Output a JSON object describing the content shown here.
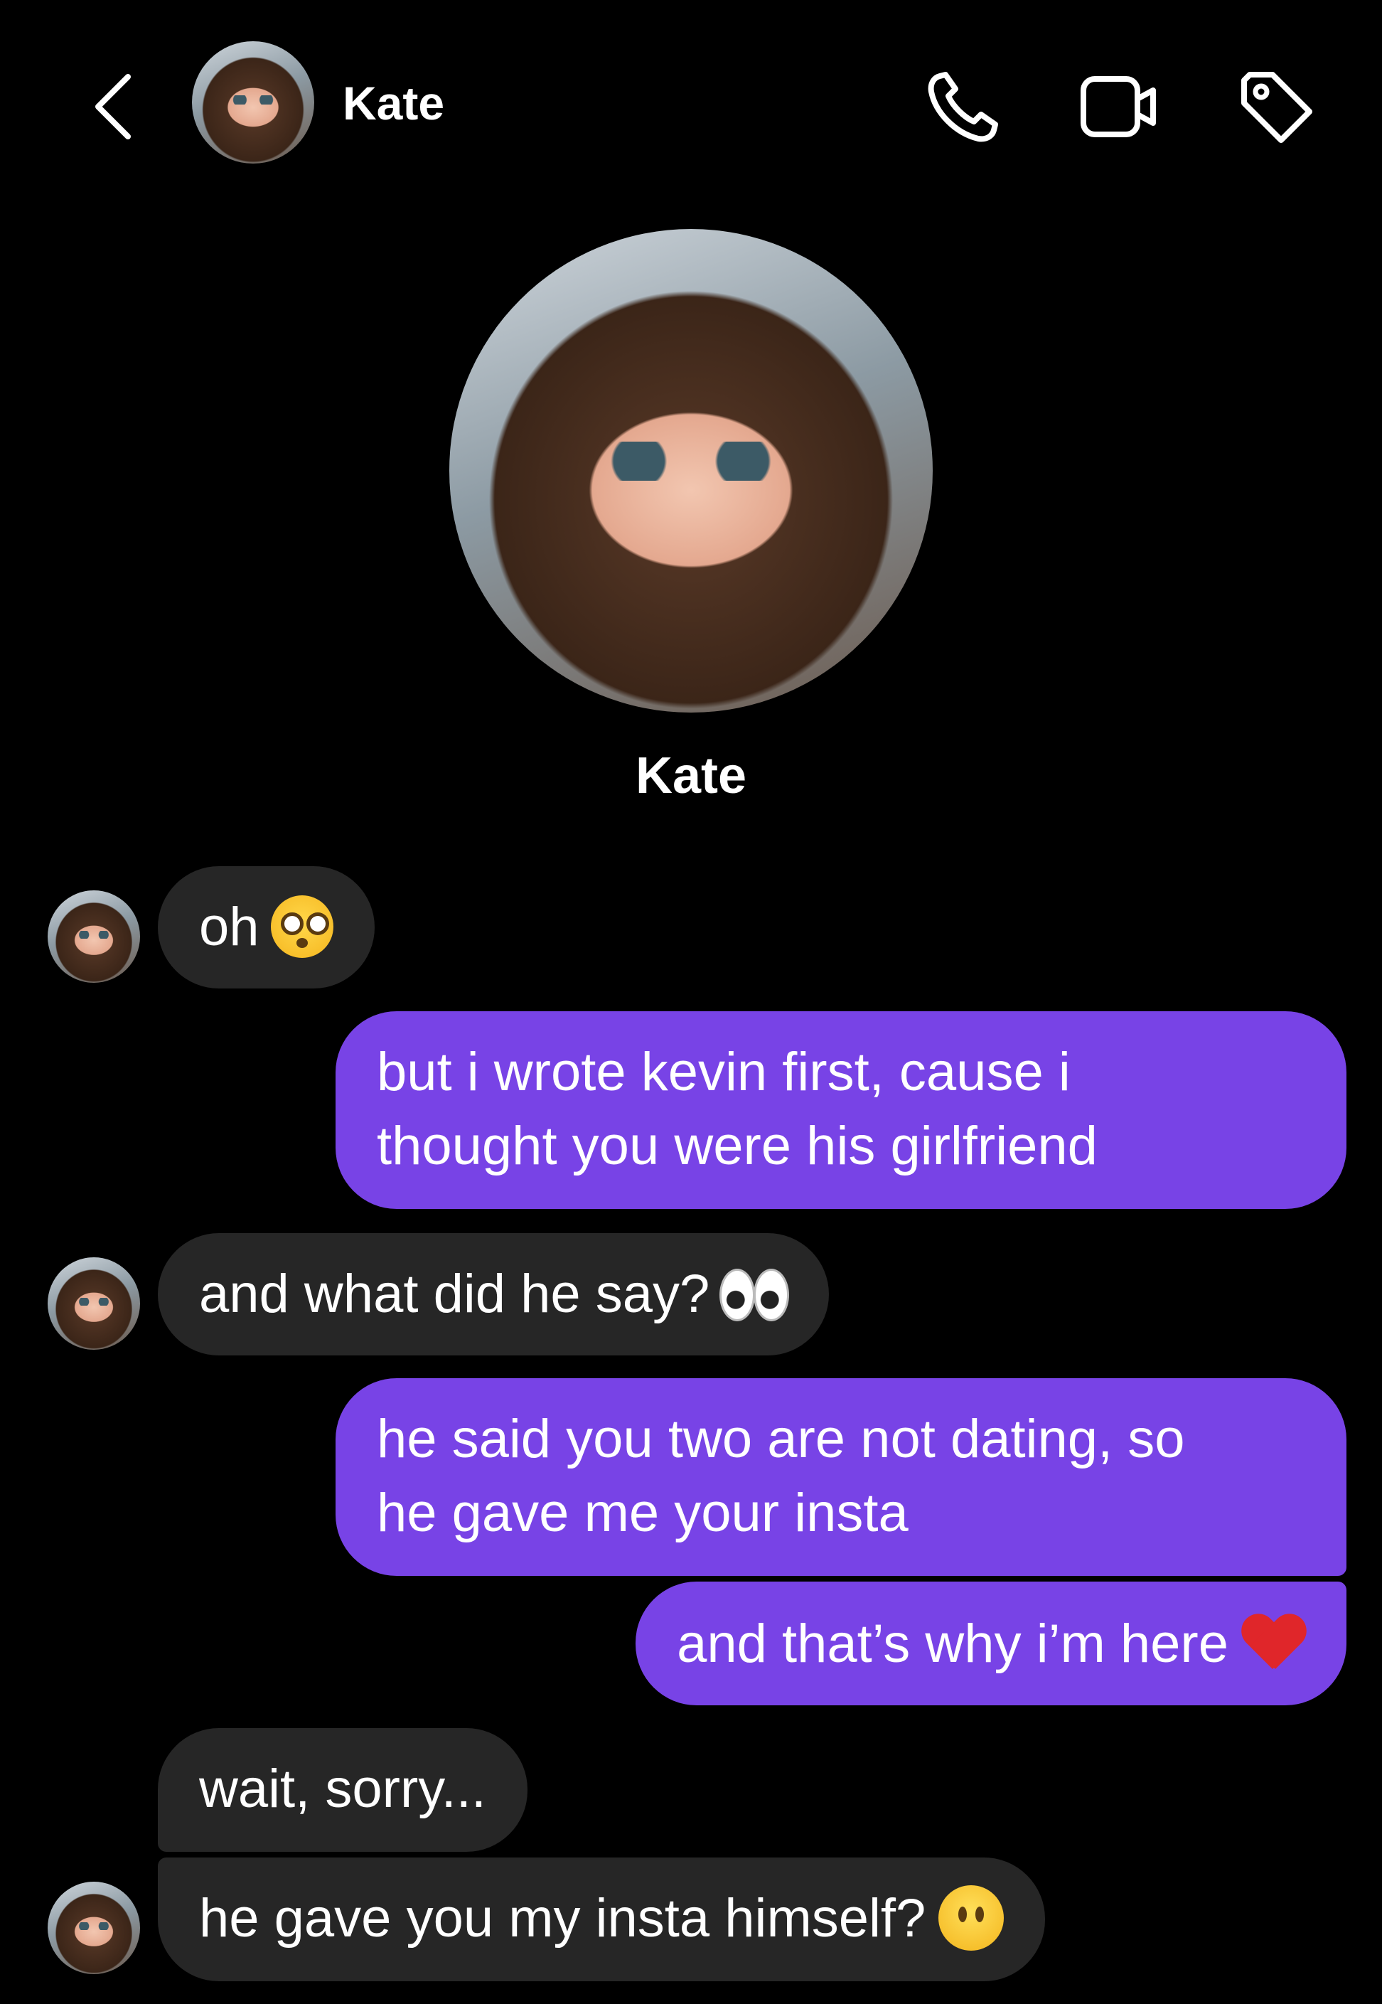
{
  "header": {
    "contact_name": "Kate",
    "icons": [
      "back-icon",
      "phone-icon",
      "video-camera-icon",
      "tag-icon"
    ]
  },
  "profile": {
    "name": "Kate"
  },
  "messages": [
    {
      "from": "them",
      "text": "oh",
      "emoji": "flushed-face"
    },
    {
      "from": "me",
      "lines": [
        "but i wrote kevin first, cause i",
        "thought you were his girlfriend"
      ]
    },
    {
      "from": "them",
      "text": "and what did he say?",
      "emoji": "eyes"
    },
    {
      "from": "me",
      "lines": [
        "he said you two are not dating, so",
        "he gave me your insta"
      ]
    },
    {
      "from": "me",
      "text": "and that’s why i’m here",
      "emoji": "red-heart"
    },
    {
      "from": "them",
      "text": "wait, sorry..."
    },
    {
      "from": "them",
      "text": "he gave you my insta himself?",
      "emoji": "face-without-mouth"
    }
  ],
  "colors": {
    "background": "#000000",
    "incoming_bubble": "#262626",
    "outgoing_bubble": "#7843e6",
    "text": "#ffffff"
  }
}
